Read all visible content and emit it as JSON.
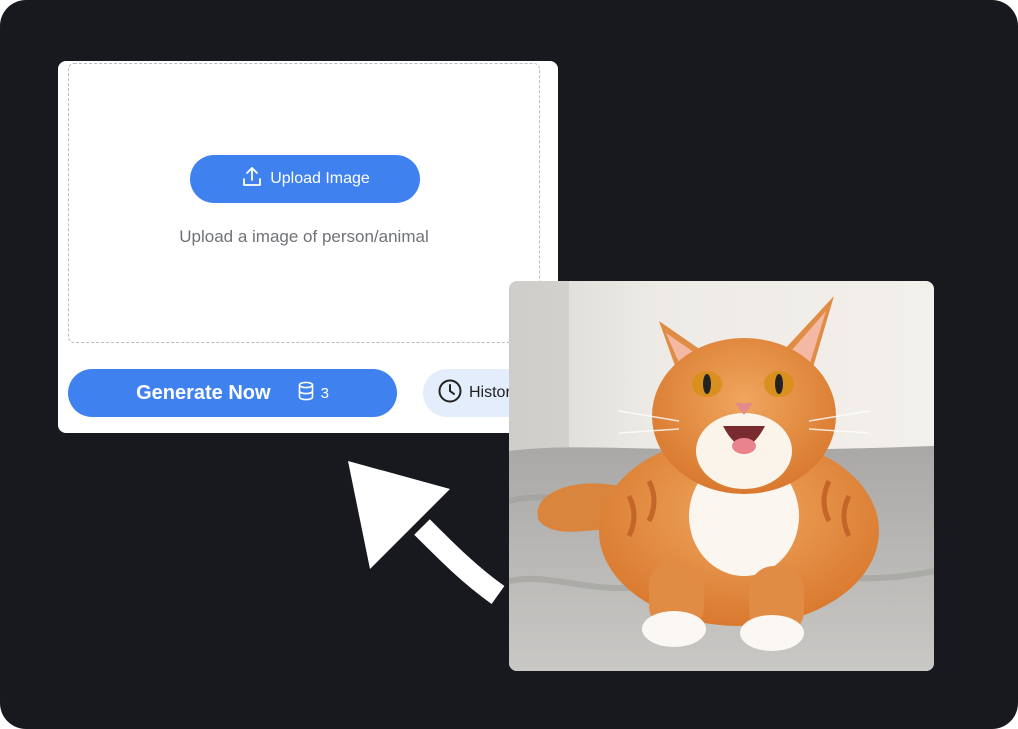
{
  "upload": {
    "button_label": "Upload Image",
    "icon": "upload-icon",
    "hint": "Upload a image of person/animal"
  },
  "actions": {
    "generate_label": "Generate Now",
    "credit_icon": "database-icon",
    "credit_count": "3",
    "history_label": "History",
    "history_icon": "clock-icon"
  },
  "colors": {
    "accent": "#3f82ef",
    "background": "#17191f",
    "history_bg": "#e4edfc"
  }
}
